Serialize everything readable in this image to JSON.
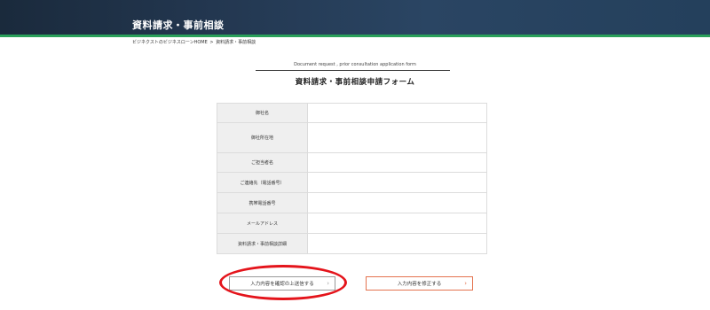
{
  "header": {
    "title": "資料請求・事前相談",
    "stripe_color": "#2aa05a"
  },
  "breadcrumb": {
    "home": "ビジネクストのビジネスローンHOME",
    "separator": ">",
    "current": "資料請求・事前相談"
  },
  "form": {
    "subtitle": "Document request , prior consultation application form",
    "title": "資料請求・事前相談申請フォーム",
    "fields": [
      {
        "label": "御社名"
      },
      {
        "label": "御社所在地"
      },
      {
        "label": "ご担当者名"
      },
      {
        "label": "ご連絡先（電話番号）"
      },
      {
        "label": "携帯電話番号"
      },
      {
        "label": "メールアドレス"
      },
      {
        "label": "資料請求・事前相談詳細"
      }
    ]
  },
  "buttons": {
    "confirm_label": "入力内容を確認の上送信する",
    "edit_label": "入力内容を修正する",
    "chevron": "›",
    "edit_accent": "#e4734f"
  },
  "annotation": {
    "color": "#e4141b",
    "shape": "ellipse",
    "target": "confirm-send-button"
  }
}
